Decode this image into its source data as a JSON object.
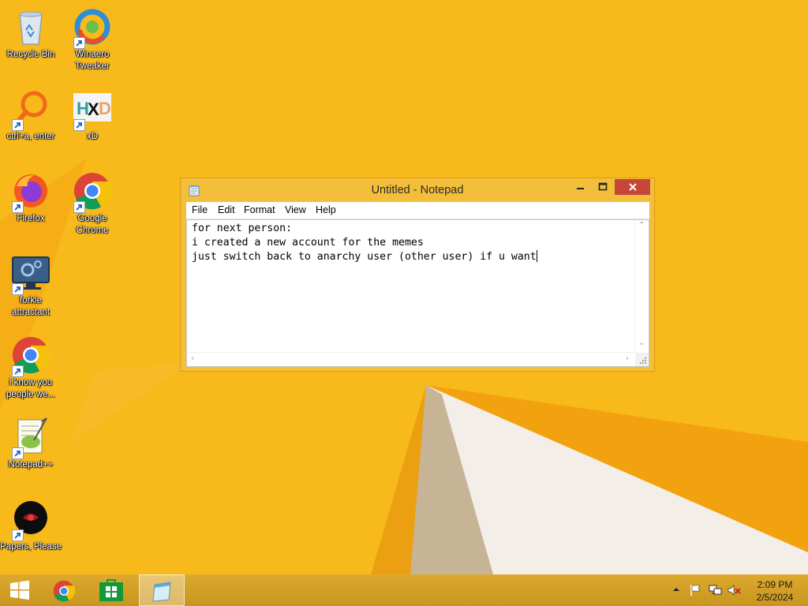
{
  "desktop": {
    "icons": [
      {
        "label": "Recycle Bin"
      },
      {
        "label": "Winaero Tweaker"
      },
      {
        "label": "ctrl+a, enter"
      },
      {
        "label": "xD"
      },
      {
        "label": "Firefox"
      },
      {
        "label": "Google Chrome"
      },
      {
        "label": "forkie attractant"
      },
      {
        "label": "i know you people we..."
      },
      {
        "label": "Notepad++"
      },
      {
        "label": "Papers, Please"
      }
    ]
  },
  "notepad": {
    "title": "Untitled - Notepad",
    "menu": [
      "File",
      "Edit",
      "Format",
      "View",
      "Help"
    ],
    "lines": [
      "for next person:",
      "i created a new account for the memes",
      "just switch back to anarchy user (other user) if u want"
    ]
  },
  "taskbar": {
    "pinned": [
      "Google Chrome",
      "Store",
      "Notepad"
    ],
    "clock": {
      "time": "2:09 PM",
      "date": "2/5/2024"
    }
  },
  "colors": {
    "wallpaper": "#f8b91b",
    "window_frame": "#f3bf3b",
    "close_button": "#c7463a",
    "taskbar": "#d6a52a"
  },
  "icons": [
    "recycle-bin-icon",
    "winaero-icon",
    "search-app-icon",
    "hxd-icon",
    "firefox-icon",
    "chrome-icon",
    "monitor-gear-icon",
    "chrome-icon",
    "notepadpp-icon",
    "papers-please-icon",
    "windows-logo-icon",
    "store-icon",
    "notepad-icon",
    "chevron-up-icon",
    "flag-icon",
    "network-icon",
    "speaker-muted-icon"
  ]
}
